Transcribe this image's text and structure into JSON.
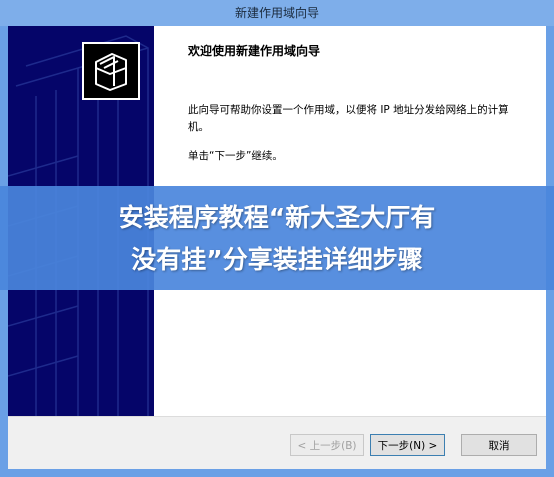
{
  "window": {
    "title": "新建作用域向导"
  },
  "wizard": {
    "heading": "欢迎使用新建作用域向导",
    "description": "此向导可帮助你设置一个作用域，以便将 IP 地址分发给网络上的计算机。",
    "hint": "单击“下一步”继续。",
    "icon": "folders-icon"
  },
  "buttons": {
    "back": "< 上一步(B)",
    "next": "下一步(N) >",
    "cancel": "取消"
  },
  "overlay": {
    "line1": "安装程序教程“新大圣大厅有",
    "line2": "没有挂”分享装挂详细步骤"
  },
  "colors": {
    "banner": "#050569",
    "overlay": "#4a85dc",
    "titlebar": "#7eaeea"
  }
}
